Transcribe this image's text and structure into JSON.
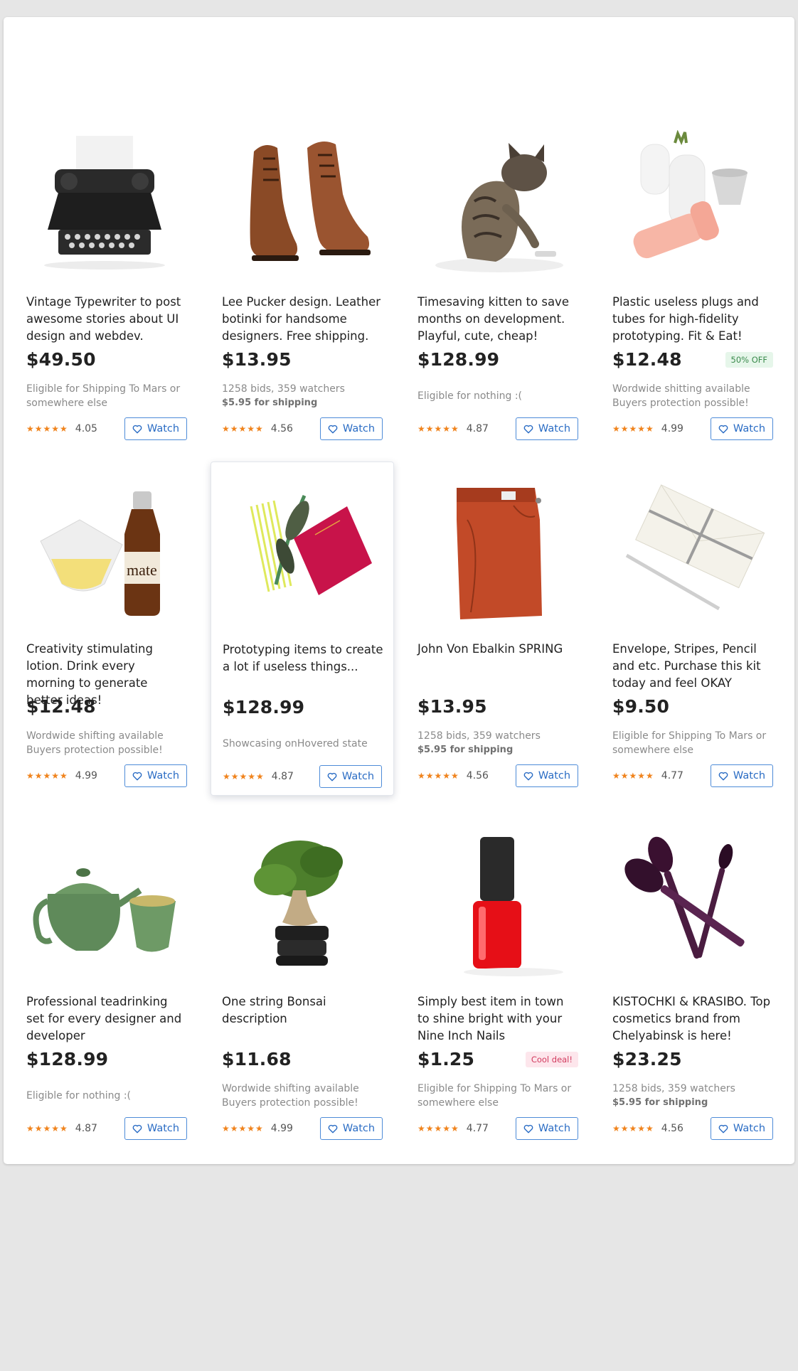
{
  "products": [
    {
      "title": "Vintage Typewriter to post awesome stories about UI design and webdev.",
      "price": "$49.50",
      "info1": "Eligible for Shipping To Mars or somewhere else",
      "info2": "",
      "badge": "",
      "rating": "4.05",
      "stars": "★★★★★",
      "watch": "Watch",
      "image": "typewriter"
    },
    {
      "title": "Lee Pucker design. Leather botinki for handsome designers. Free shipping.",
      "price": "$13.95",
      "info1": "1258 bids, 359 watchers",
      "info2": "$5.95 for shipping",
      "badge": "",
      "rating": "4.56",
      "stars": "★★★★★",
      "watch": "Watch",
      "image": "boots"
    },
    {
      "title": "Timesaving kitten to save months on development. Playful, cute, cheap!",
      "price": "$128.99",
      "info1": "Eligible for nothing :(",
      "info2": "",
      "badge": "",
      "rating": "4.87",
      "stars": "★★★★★",
      "watch": "Watch",
      "image": "kitten"
    },
    {
      "title": "Plastic useless plugs and tubes for high-fidelity prototyping. Fit & Eat!",
      "price": "$12.48",
      "info1": "Wordwide shitting available",
      "info2": "Buyers protection possible!",
      "badge": "50% OFF",
      "rating": "4.99",
      "stars": "★★★★★",
      "watch": "Watch",
      "image": "vases"
    },
    {
      "title": "Creativity stimulating lotion. Drink every morning to generate better ideas!",
      "price": "$12.48",
      "info1": "Wordwide shifting available",
      "info2": "Buyers protection possible!",
      "badge": "",
      "rating": "4.99",
      "stars": "★★★★★",
      "watch": "Watch",
      "image": "mate"
    },
    {
      "title": "Prototyping items to create a lot if useless things...",
      "price": "$128.99",
      "info1": "Showcasing onHovered state",
      "info2": "",
      "badge": "",
      "rating": "4.87",
      "stars": "★★★★★",
      "watch": "Watch",
      "image": "notebook"
    },
    {
      "title": "John Von Ebalkin SPRING",
      "price": "$13.95",
      "info1": "1258 bids, 359 watchers",
      "info2": "$5.95 for shipping",
      "badge": "",
      "rating": "4.56",
      "stars": "★★★★★",
      "watch": "Watch",
      "image": "pants"
    },
    {
      "title": "Envelope, Stripes, Pencil and etc. Purchase this kit today and feel OKAY",
      "price": "$9.50",
      "info1": "Eligible for Shipping To Mars or somewhere else",
      "info2": "",
      "badge": "",
      "rating": "4.77",
      "stars": "★★★★★",
      "watch": "Watch",
      "image": "envelope"
    },
    {
      "title": "Professional teadrinking set for every designer and developer",
      "price": "$128.99",
      "info1": "Eligible for nothing :(",
      "info2": "",
      "badge": "",
      "rating": "4.87",
      "stars": "★★★★★",
      "watch": "Watch",
      "image": "teaset"
    },
    {
      "title": "One string Bonsai description",
      "price": "$11.68",
      "info1": "Wordwide shifting available",
      "info2": "Buyers protection possible!",
      "badge": "",
      "rating": "4.99",
      "stars": "★★★★★",
      "watch": "Watch",
      "image": "bonsai"
    },
    {
      "title": "Simply best item in town to shine bright with your Nine Inch Nails",
      "price": "$1.25",
      "info1": "Eligible for Shipping To Mars or somewhere else",
      "info2": "",
      "badge": "Cool deal!",
      "rating": "4.77",
      "stars": "★★★★★",
      "watch": "Watch",
      "image": "nailpolish"
    },
    {
      "title": "KISTOCHKI & KRASIBO. Top cosmetics brand from Chelyabinsk is here!",
      "price": "$23.25",
      "info1": "1258 bids, 359 watchers",
      "info2": "$5.95 for shipping",
      "badge": "",
      "rating": "4.56",
      "stars": "★★★★★",
      "watch": "Watch",
      "image": "brushes"
    }
  ],
  "colors": {
    "accent": "#2a6cc4",
    "star": "#f0831c",
    "badge_green": "#3a8a4c",
    "badge_pink": "#d23b5e"
  }
}
